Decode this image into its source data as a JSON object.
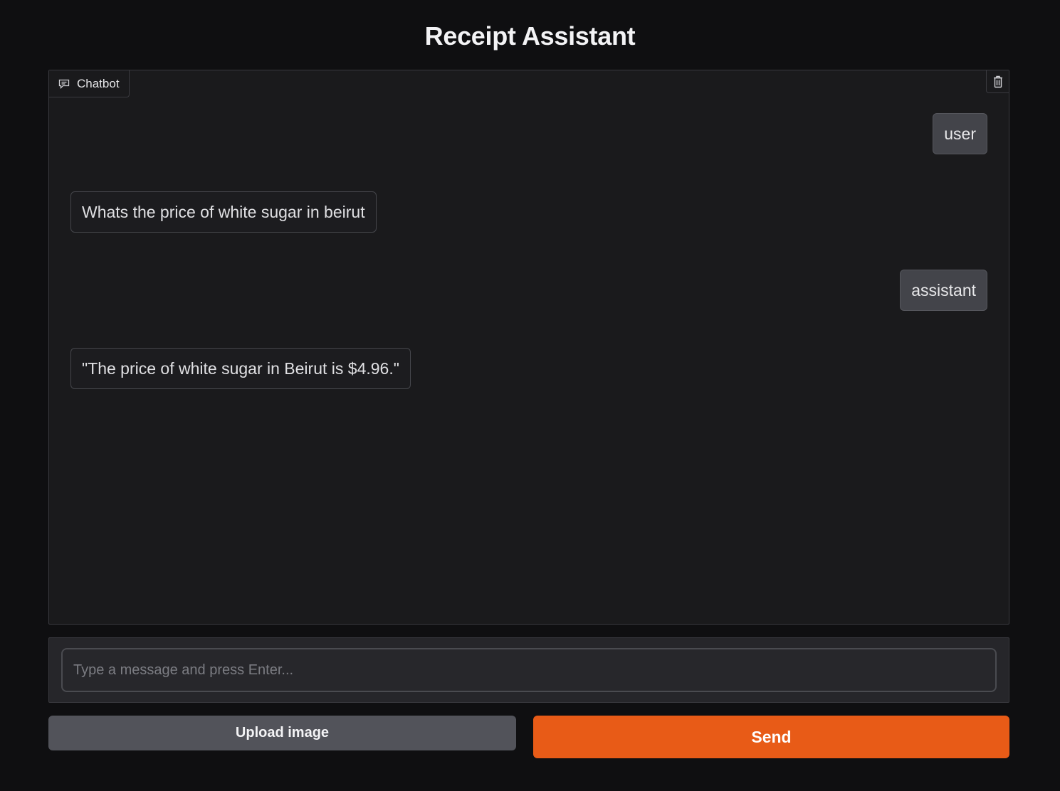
{
  "page": {
    "title": "Receipt Assistant"
  },
  "chatbot": {
    "label": "Chatbot",
    "label_icon": "chat-bubble-icon",
    "clear_icon": "trash-icon",
    "messages": [
      {
        "role_side": "right",
        "text": "user"
      },
      {
        "role_side": "left",
        "text": "Whats the price of white sugar in beirut"
      },
      {
        "role_side": "right",
        "text": "assistant"
      },
      {
        "role_side": "left",
        "text": "\"The price of white sugar in Beirut is $4.96.\""
      }
    ]
  },
  "composer": {
    "placeholder": "Type a message and press Enter...",
    "value": ""
  },
  "actions": {
    "upload_label": "Upload image",
    "send_label": "Send"
  },
  "colors": {
    "background": "#0f0f11",
    "panel": "#1a1a1c",
    "accent": "#e85b17",
    "secondary_button": "#52535a"
  }
}
